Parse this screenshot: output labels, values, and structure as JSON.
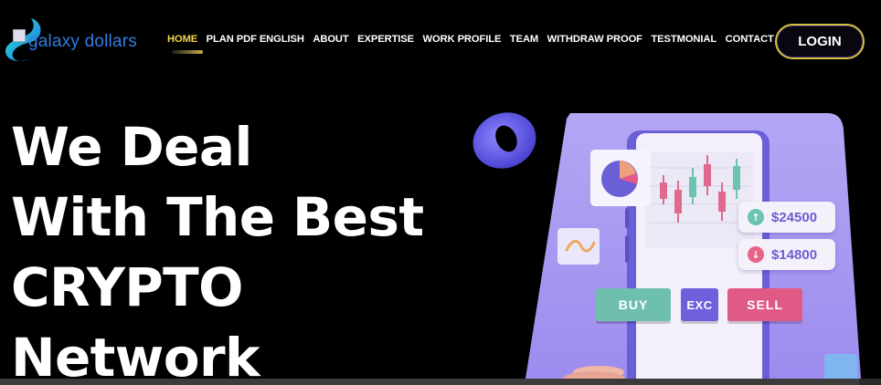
{
  "brand": {
    "name": "galaxy dollars",
    "logo_icon": "swirl-logo-icon"
  },
  "nav": {
    "items": [
      {
        "label": "HOME",
        "active": true
      },
      {
        "label": "PLAN PDF ENGLISH",
        "active": false
      },
      {
        "label": "ABOUT",
        "active": false
      },
      {
        "label": "EXPERTISE",
        "active": false
      },
      {
        "label": "WORK PROFILE",
        "active": false
      },
      {
        "label": "TEAM",
        "active": false
      },
      {
        "label": "WITHDRAW PROOF",
        "active": false
      },
      {
        "label": "TESTMONIAL",
        "active": false
      },
      {
        "label": "CONTACT",
        "active": false
      }
    ],
    "login_label": "LOGIN"
  },
  "hero": {
    "line1": "We Deal",
    "line2": "With The Best",
    "line3": "CRYPTO",
    "line4": "Network"
  },
  "illustration": {
    "price_up": "$24500",
    "price_down": "$14800",
    "buy_label": "BUY",
    "exc_label": "EXC",
    "sell_label": "SELL",
    "colors": {
      "panel": "#a99af0",
      "phone": "#f3f0fb",
      "accent": "#6e5fdc",
      "buy": "#6fbfae",
      "sell": "#e05a86"
    }
  },
  "colors": {
    "background": "#000000",
    "active_nav": "#f2d64b",
    "brand_text": "#2f7de1",
    "login_border": "#d8c13e"
  }
}
